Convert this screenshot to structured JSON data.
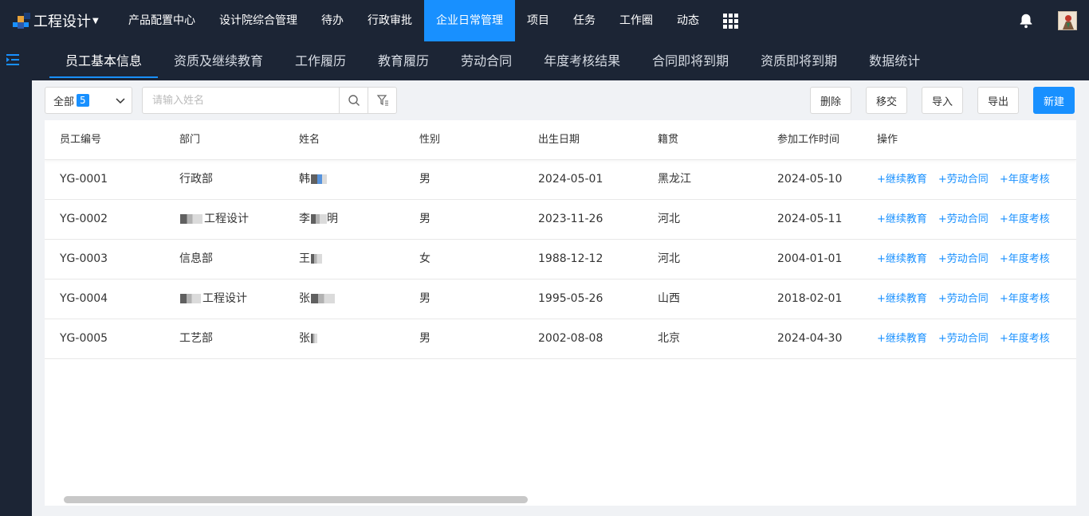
{
  "app": {
    "title": "工程设计"
  },
  "colors": {
    "accent": "#1890ff",
    "nav_bg": "#1c2535",
    "link": "#1890ff"
  },
  "topnav": {
    "items": [
      {
        "label": "产品配置中心"
      },
      {
        "label": "设计院综合管理"
      },
      {
        "label": "待办"
      },
      {
        "label": "行政审批"
      },
      {
        "label": "企业日常管理",
        "active": true
      },
      {
        "label": "项目"
      },
      {
        "label": "任务"
      },
      {
        "label": "工作圈"
      },
      {
        "label": "动态"
      }
    ],
    "icons": [
      "apps-grid-icon",
      "bell-icon",
      "avatar"
    ]
  },
  "subtabs": [
    {
      "label": "员工基本信息",
      "active": true
    },
    {
      "label": "资质及继续教育"
    },
    {
      "label": "工作履历"
    },
    {
      "label": "教育履历"
    },
    {
      "label": "劳动合同"
    },
    {
      "label": "年度考核结果"
    },
    {
      "label": "合同即将到期"
    },
    {
      "label": "资质即将到期"
    },
    {
      "label": "数据统计"
    }
  ],
  "toolbar": {
    "filter_label": "全部",
    "filter_count": "5",
    "search_placeholder": "请输入姓名",
    "buttons": {
      "delete": "删除",
      "transfer": "移交",
      "import": "导入",
      "export": "导出",
      "create": "新建"
    }
  },
  "table": {
    "headers": [
      "员工编号",
      "部门",
      "姓名",
      "性别",
      "出生日期",
      "籍贯",
      "参加工作时间",
      "操作"
    ],
    "rows": [
      {
        "id": "YG-0001",
        "dept": "行政部",
        "name": "韩",
        "gender": "男",
        "birth": "2024-05-01",
        "origin": "黑龙江",
        "work_start": "2024-05-10"
      },
      {
        "id": "YG-0002",
        "dept": "工程设计",
        "name": "李",
        "name_tail": "明",
        "gender": "男",
        "birth": "2023-11-26",
        "origin": "河北",
        "work_start": "2024-05-11"
      },
      {
        "id": "YG-0003",
        "dept": "信息部",
        "name": "王",
        "gender": "女",
        "birth": "1988-12-12",
        "origin": "河北",
        "work_start": "2004-01-01"
      },
      {
        "id": "YG-0004",
        "dept": "工程设计",
        "name": "张",
        "gender": "男",
        "birth": "1995-05-26",
        "origin": "山西",
        "work_start": "2018-02-01"
      },
      {
        "id": "YG-0005",
        "dept": "工艺部",
        "name": "张",
        "gender": "男",
        "birth": "2002-08-08",
        "origin": "北京",
        "work_start": "2024-04-30"
      }
    ],
    "actions": [
      "+继续教育",
      "+劳动合同",
      "+年度考核"
    ]
  }
}
